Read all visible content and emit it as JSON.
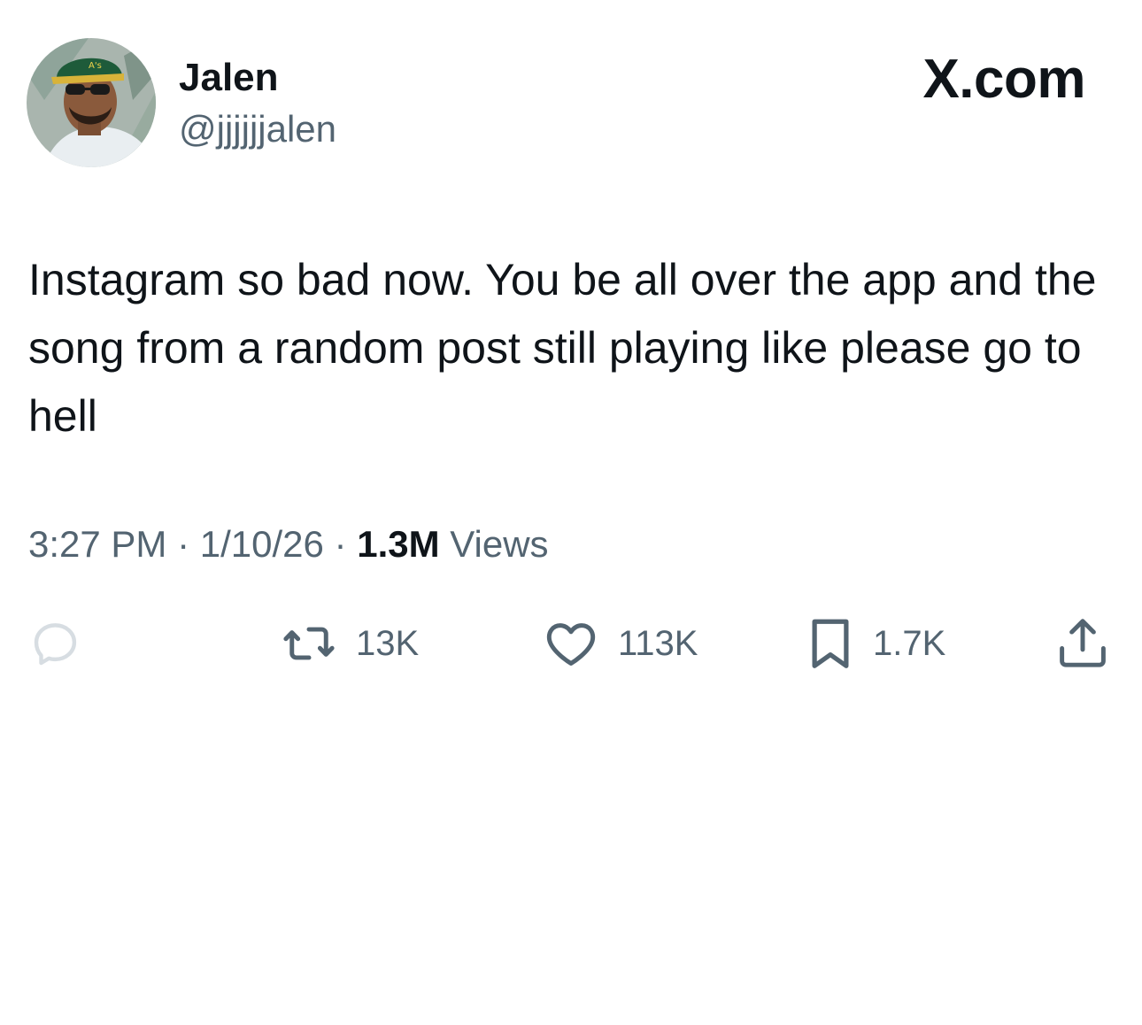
{
  "header": {
    "name": "Jalen",
    "handle": "@jjjjjjalen",
    "brand": "X.com",
    "avatar_icon": "profile-photo"
  },
  "tweet": {
    "text": "Instagram so bad now. You be all over the app and the song from a random post still playing like please go to hell"
  },
  "meta": {
    "time": "3:27 PM",
    "separator": " · ",
    "date": "1/10/26",
    "views_count": "1.3M",
    "views_label": " Views"
  },
  "actions": {
    "reply": {
      "icon": "reply-icon",
      "count": ""
    },
    "retweet": {
      "icon": "retweet-icon",
      "count": "13K"
    },
    "like": {
      "icon": "heart-icon",
      "count": "113K"
    },
    "bookmark": {
      "icon": "bookmark-icon",
      "count": "1.7K"
    },
    "share": {
      "icon": "share-icon"
    }
  },
  "colors": {
    "text_primary": "#0f1419",
    "text_secondary": "#536471",
    "background": "#ffffff"
  }
}
